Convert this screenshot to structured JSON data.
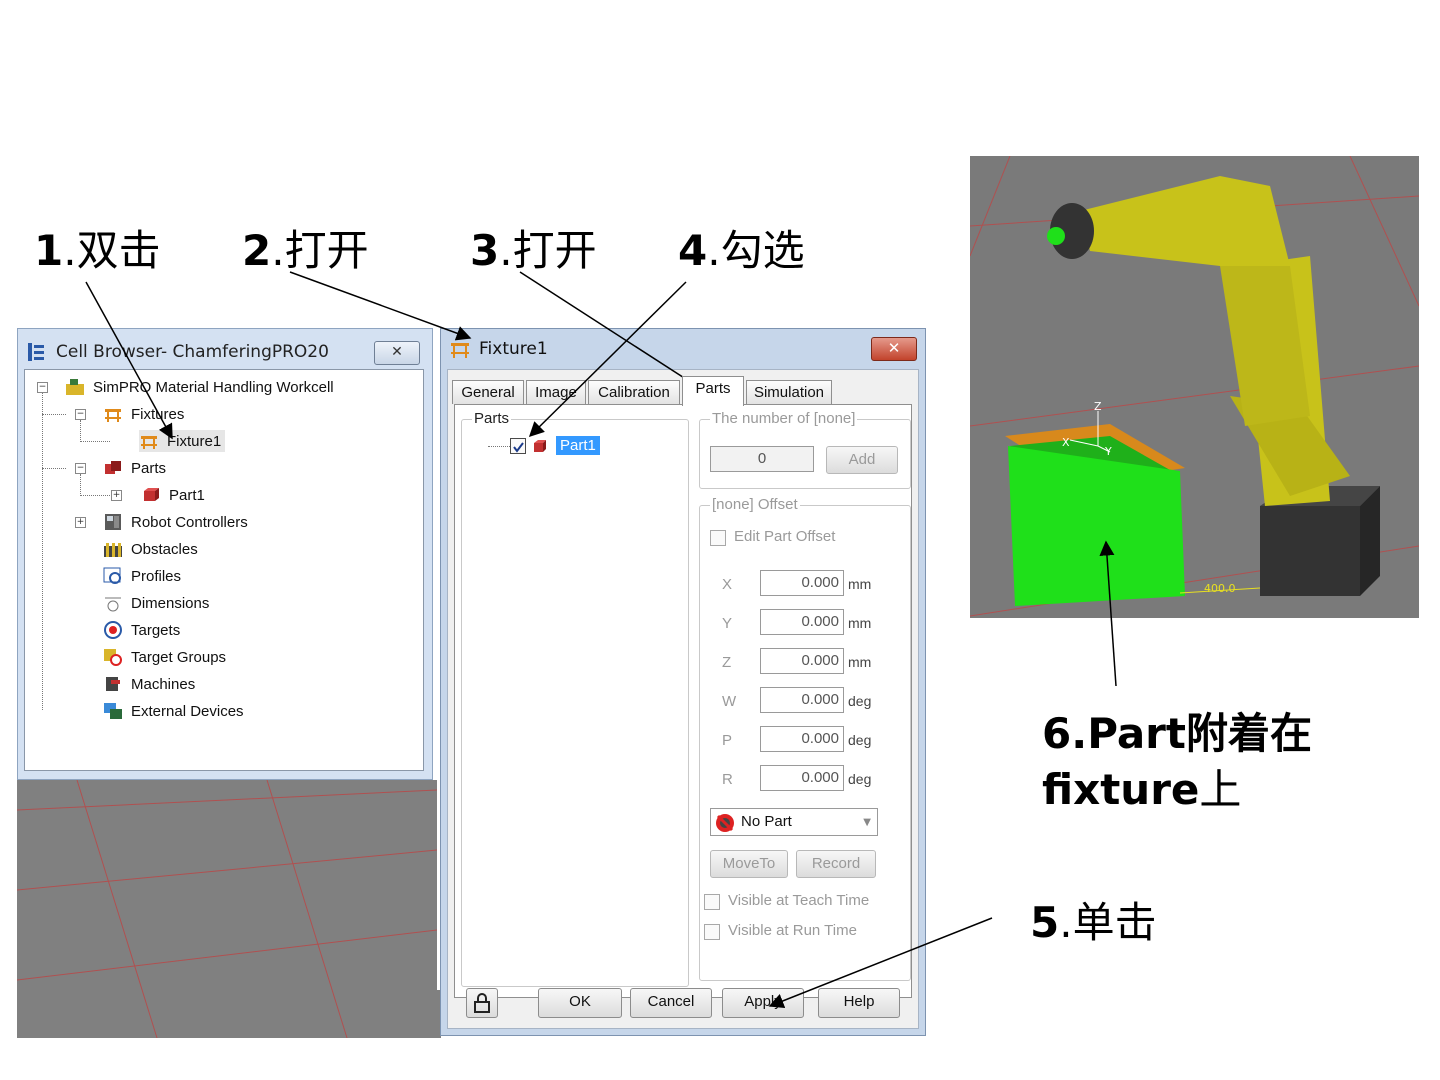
{
  "steps": {
    "s1": {
      "num": "1",
      "text": ".双击"
    },
    "s2": {
      "num": "2",
      "text": ".打开"
    },
    "s3": {
      "num": "3",
      "text": ".打开"
    },
    "s4": {
      "num": "4",
      "text": ".勾选"
    },
    "s5": {
      "num": "5",
      "text": ".单击"
    },
    "s6": {
      "num": "6",
      "line1": ".Part附着在",
      "line2a": "fixture",
      "line2b": "上"
    }
  },
  "cell_browser": {
    "title": "Cell Browser- ChamferingPRO20",
    "close": "✕",
    "tree": [
      {
        "label": "SimPRO Material Handling Workcell"
      },
      {
        "label": "Fixtures"
      },
      {
        "label": "Fixture1"
      },
      {
        "label": "Parts"
      },
      {
        "label": "Part1"
      },
      {
        "label": "Robot Controllers"
      },
      {
        "label": "Obstacles"
      },
      {
        "label": "Profiles"
      },
      {
        "label": "Dimensions"
      },
      {
        "label": "Targets"
      },
      {
        "label": "Target Groups"
      },
      {
        "label": "Machines"
      },
      {
        "label": "External Devices"
      }
    ]
  },
  "fixture_dialog": {
    "title": "Fixture1",
    "close": "✕",
    "tabs": [
      "General",
      "Image",
      "Calibration",
      "Parts",
      "Simulation"
    ],
    "active_tab": "Parts",
    "parts_group": "Parts",
    "part_item": "Part1",
    "number_group": "The number of [none]",
    "number_value": "0",
    "add_button": "Add",
    "offset_group": "[none] Offset",
    "edit_offset": "Edit Part Offset",
    "offsets": [
      {
        "axis": "X",
        "value": "0.000",
        "unit": "mm"
      },
      {
        "axis": "Y",
        "value": "0.000",
        "unit": "mm"
      },
      {
        "axis": "Z",
        "value": "0.000",
        "unit": "mm"
      },
      {
        "axis": "W",
        "value": "0.000",
        "unit": "deg"
      },
      {
        "axis": "P",
        "value": "0.000",
        "unit": "deg"
      },
      {
        "axis": "R",
        "value": "0.000",
        "unit": "deg"
      }
    ],
    "part_select": "No Part",
    "moveto_button": "MoveTo",
    "record_button": "Record",
    "visible_teach": "Visible at Teach Time",
    "visible_run": "Visible at Run Time",
    "buttons": {
      "ok": "OK",
      "cancel": "Cancel",
      "apply": "Apply",
      "help": "Help"
    }
  },
  "viewport": {
    "dimension_label": "400.0",
    "axis_z": "Z",
    "axis_x": "X",
    "axis_y": "Y"
  },
  "colors": {
    "robot_yellow": "#c8c21a",
    "part_green": "#1fe01a",
    "fixture_orange": "#d8891c"
  }
}
